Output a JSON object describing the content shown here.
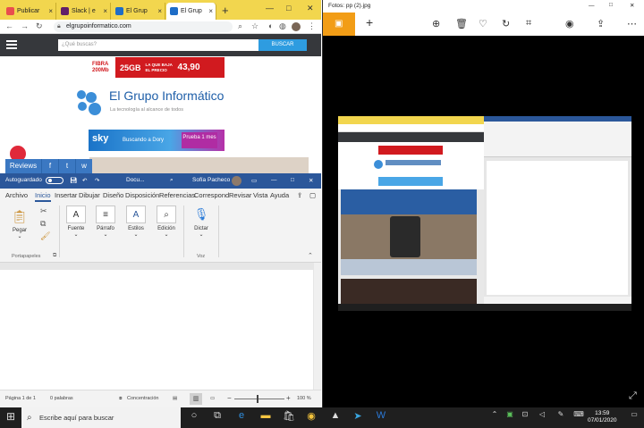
{
  "chrome": {
    "tabs": [
      {
        "label": "Publicar",
        "favicon_color": "#e94e4e"
      },
      {
        "label": "Slack | e",
        "favicon_color": "#611f69"
      },
      {
        "label": "El Grup",
        "favicon_color": "#1e6dc7"
      },
      {
        "label": "El Grup",
        "favicon_color": "#1e6dc7"
      }
    ],
    "url": "elgrupoinformatico.com",
    "search_placeholder": "¿Qué buscas?",
    "search_button": "BUSCAR",
    "ad_top": {
      "fibra": "FIBRA 200Mb",
      "gb": "25GB",
      "promo": "LA QUE BAJA EL PRECIO",
      "price": "43,90"
    },
    "logo_title": "El Grupo Informático",
    "logo_tagline": "La tecnología al alcance de todos",
    "ad_sky": {
      "brand": "sky",
      "text": "Buscando a Dory",
      "cta": "Prueba 1 mes"
    },
    "reviews_label": "Reviews",
    "share_icons": [
      "f",
      "t",
      "w"
    ]
  },
  "word": {
    "autosave_label": "Autoguardado",
    "doc_name": "Docu...",
    "user_name": "Sofía Pacheco",
    "tabs": [
      "Archivo",
      "Inicio",
      "Insertar",
      "Dibujar",
      "Diseño",
      "Disposición",
      "Referencias",
      "Correspond",
      "Revisar",
      "Vista",
      "Ayuda"
    ],
    "active_tab": "Inicio",
    "ribbon": {
      "pegar": "Pegar",
      "portapapeles": "Portapapeles",
      "fuente": "Fuente",
      "parrafo": "Párrafo",
      "estilos": "Estilos",
      "edicion": "Edición",
      "dictar": "Dictar",
      "voz": "Voz"
    },
    "status": {
      "page": "Página 1 de 1",
      "words": "0 palabras",
      "focus": "Concentración",
      "zoom": "100 %"
    }
  },
  "photos": {
    "title": "Fotos: pp (2).jpg"
  },
  "taskbar": {
    "search_placeholder": "Escribe aquí para buscar",
    "time": "13:59",
    "date": "07/01/2020"
  },
  "colors": {
    "chrome_tab_bar": "#f2d64e",
    "site_header": "#36383c",
    "word_blue": "#2b579a",
    "photos_accent": "#f29d16",
    "taskbar": "#1f1f1f"
  }
}
